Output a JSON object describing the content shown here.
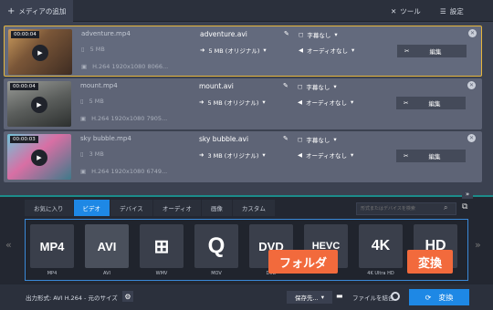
{
  "toolbar": {
    "add_media": "メディアの追加",
    "tools": "ツール",
    "settings": "設定"
  },
  "files": [
    {
      "timecode": "00:00:04",
      "name": "adventure.mp4",
      "size": "5 MB",
      "meta": "H.264 1920x1080 8066...",
      "out_name": "adventure.avi",
      "out_size": "5 MB (オリジナル)",
      "subtitle": "字幕なし",
      "audio": "オーディオなし",
      "edit": "編集"
    },
    {
      "timecode": "00:00:04",
      "name": "mount.mp4",
      "size": "5 MB",
      "meta": "H.264 1920x1080 7905...",
      "out_name": "mount.avi",
      "out_size": "5 MB (オリジナル)",
      "subtitle": "字幕なし",
      "audio": "オーディオなし",
      "edit": "編集"
    },
    {
      "timecode": "00:00:03",
      "name": "sky bubble.mp4",
      "size": "3 MB",
      "meta": "H.264 1920x1080 6749...",
      "out_name": "sky bubble.avi",
      "out_size": "3 MB (オリジナル)",
      "subtitle": "字幕なし",
      "audio": "オーディオなし",
      "edit": "編集"
    }
  ],
  "tabs": [
    "お気に入り",
    "ビデオ",
    "デバイス",
    "オーディオ",
    "画像",
    "カスタム"
  ],
  "active_tab": "ビデオ",
  "search": {
    "placeholder": "形式またはデバイスを検索"
  },
  "formats": [
    {
      "icon": "MP4",
      "label": "MP4"
    },
    {
      "icon": "AVI",
      "label": "AVI"
    },
    {
      "icon": "WMV",
      "label": "WMV"
    },
    {
      "icon": "Q",
      "label": "MOV"
    },
    {
      "icon": "DVD",
      "label": "DVD"
    },
    {
      "icon": "HEVC",
      "label": ""
    },
    {
      "icon": "4K",
      "label": "4K Ultra HD"
    },
    {
      "icon": "HD",
      "label": ""
    }
  ],
  "status": {
    "output_format": "出力形式: AVI H.264 - 元のサイズ",
    "save_to": "保存先...",
    "merge": "ファイルを結合",
    "convert": "変換"
  },
  "callouts": {
    "folder": "フォルダ",
    "convert": "変換"
  },
  "colors": {
    "accent": "#1e88e5",
    "callout": "#f26a3c",
    "selected_border": "#e6b63c"
  }
}
